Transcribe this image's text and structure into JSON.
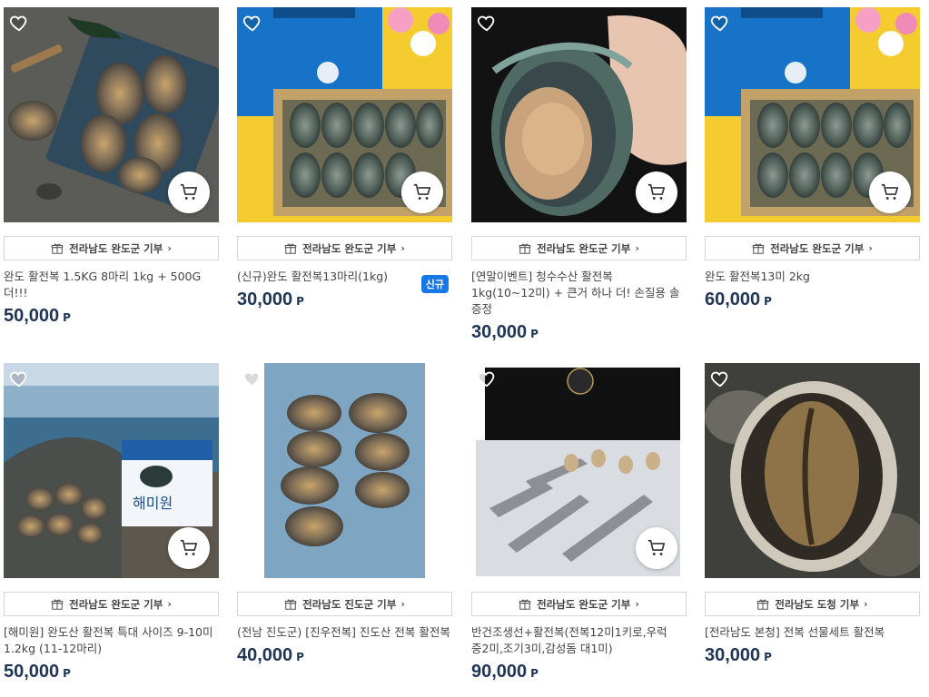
{
  "products": [
    {
      "image": "abalone-platter-knife",
      "donation": "전라남도 완도군 기부",
      "name": "완도 활전복 1.5KG 8마리 1kg + 500G 더!!!",
      "price": "50,000",
      "unit": "P",
      "badge": ""
    },
    {
      "image": "abalone-basket-bag",
      "donation": "전라남도 완도군 기부",
      "name": "(신규)완도 활전복13마리(1kg)",
      "price": "30,000",
      "unit": "P",
      "badge": "신규"
    },
    {
      "image": "abalone-held-hand",
      "donation": "전라남도 완도군 기부",
      "name": "[연말이벤트] 청수수산 활전복 1kg(10~12미) + 큰거 하나 더! 손질용 솔 증정",
      "price": "30,000",
      "unit": "P",
      "badge": ""
    },
    {
      "image": "abalone-basket-bag",
      "donation": "전라남도 완도군 기부",
      "name": "완도 활전복13미 2kg",
      "price": "60,000",
      "unit": "P",
      "badge": ""
    },
    {
      "image": "abalone-sea-box",
      "donation": "전라남도 완도군 기부",
      "name": "[해미원] 완도산 활전복 특대 사이즈 9-10미 1.2kg (11-12마리)",
      "price": "50,000",
      "unit": "P",
      "badge": ""
    },
    {
      "image": "abalone-tray-blue",
      "donation": "전라남도 진도군 기부",
      "name": "(전남 진도군) [진우전복] 진도산 전복 활전복",
      "price": "40,000",
      "unit": "P",
      "badge": ""
    },
    {
      "image": "dried-fish-box",
      "donation": "전라남도 완도군 기부",
      "name": "반건조생선+활전복(전복12미1키로,우럭 중2미,조기3미,감성돔 대1미)",
      "price": "90,000",
      "unit": "P",
      "badge": ""
    },
    {
      "image": "abalone-closeup",
      "donation": "전라남도 도청 기부",
      "name": "[전라남도 본청] 전복 선물세트 활전복",
      "price": "30,000",
      "unit": "P",
      "badge": ""
    }
  ]
}
